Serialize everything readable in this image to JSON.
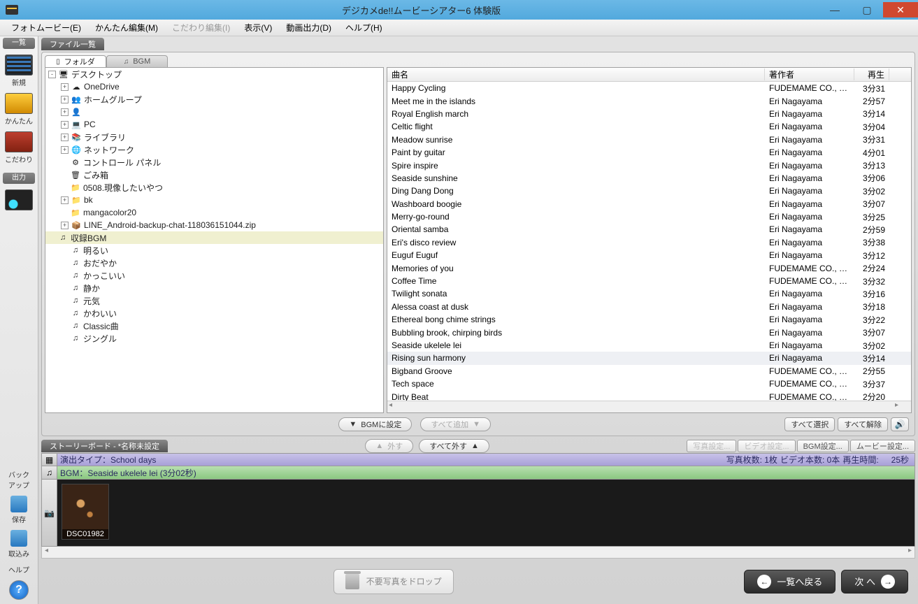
{
  "titlebar": {
    "title": "デジカメde!!ムービーシアター6 体験版"
  },
  "menu": {
    "items": [
      "フォトムービー(E)",
      "かんたん編集(M)",
      "こだわり編集(I)",
      "表示(V)",
      "動画出力(D)",
      "ヘルプ(H)"
    ]
  },
  "rail": {
    "list": "一覧",
    "buttons": {
      "new": "新規",
      "kantan": "かんたん",
      "kodawari": "こだわり"
    },
    "output": "出力",
    "backup": "バック\nアップ",
    "save": "保存",
    "load": "取込み",
    "help": "ヘルプ"
  },
  "file_tab": "ファイル一覧",
  "tabs": {
    "folder": "フォルダ",
    "bgm": "BGM"
  },
  "tree": [
    {
      "lvl": 0,
      "exp": "-",
      "icon": "🖥",
      "label": "デスクトップ"
    },
    {
      "lvl": 1,
      "exp": "+",
      "icon": "☁",
      "label": "OneDrive"
    },
    {
      "lvl": 1,
      "exp": "+",
      "icon": "👥",
      "label": "ホームグループ"
    },
    {
      "lvl": 1,
      "exp": "+",
      "icon": "👤",
      "label": "　　　　"
    },
    {
      "lvl": 1,
      "exp": "+",
      "icon": "💻",
      "label": "PC"
    },
    {
      "lvl": 1,
      "exp": "+",
      "icon": "📚",
      "label": "ライブラリ"
    },
    {
      "lvl": 1,
      "exp": "+",
      "icon": "🌐",
      "label": "ネットワーク"
    },
    {
      "lvl": 1,
      "exp": "",
      "icon": "⚙",
      "label": "コントロール パネル"
    },
    {
      "lvl": 1,
      "exp": "",
      "icon": "🗑",
      "label": "ごみ箱"
    },
    {
      "lvl": 1,
      "exp": "",
      "icon": "📁",
      "label": "0508.現像したいやつ"
    },
    {
      "lvl": 1,
      "exp": "+",
      "icon": "📁",
      "label": "bk"
    },
    {
      "lvl": 1,
      "exp": "",
      "icon": "📁",
      "label": "mangacolor20"
    },
    {
      "lvl": 1,
      "exp": "+",
      "icon": "📦",
      "label": "LINE_Android-backup-chat-118036151044.zip"
    },
    {
      "lvl": 0,
      "exp": "",
      "icon": "♫",
      "label": "収録BGM",
      "sel": true
    },
    {
      "lvl": 1,
      "exp": "",
      "icon": "♫",
      "label": "明るい"
    },
    {
      "lvl": 1,
      "exp": "",
      "icon": "♫",
      "label": "おだやか"
    },
    {
      "lvl": 1,
      "exp": "",
      "icon": "♫",
      "label": "かっこいい"
    },
    {
      "lvl": 1,
      "exp": "",
      "icon": "♫",
      "label": "静か"
    },
    {
      "lvl": 1,
      "exp": "",
      "icon": "♫",
      "label": "元気"
    },
    {
      "lvl": 1,
      "exp": "",
      "icon": "♫",
      "label": "かわいい"
    },
    {
      "lvl": 1,
      "exp": "",
      "icon": "♫",
      "label": "Classic曲"
    },
    {
      "lvl": 1,
      "exp": "",
      "icon": "♫",
      "label": "ジングル"
    }
  ],
  "list": {
    "headers": {
      "title": "曲名",
      "author": "著作者",
      "play": "再生"
    },
    "rows": [
      {
        "t": "Happy Cycling",
        "a": "FUDEMAME CO., L...",
        "d": "3分31"
      },
      {
        "t": "Meet me in the islands",
        "a": "Eri Nagayama",
        "d": "2分57"
      },
      {
        "t": "Royal English march",
        "a": "Eri Nagayama",
        "d": "3分14"
      },
      {
        "t": "Celtic flight",
        "a": "Eri Nagayama",
        "d": "3分04"
      },
      {
        "t": "Meadow sunrise",
        "a": "Eri Nagayama",
        "d": "3分31"
      },
      {
        "t": "Paint by guitar",
        "a": "Eri Nagayama",
        "d": "4分01"
      },
      {
        "t": "Spire inspire",
        "a": "Eri Nagayama",
        "d": "3分13"
      },
      {
        "t": "Seaside sunshine",
        "a": "Eri Nagayama",
        "d": "3分06"
      },
      {
        "t": "Ding Dang Dong",
        "a": "Eri Nagayama",
        "d": "3分02"
      },
      {
        "t": "Washboard boogie",
        "a": "Eri Nagayama",
        "d": "3分07"
      },
      {
        "t": "Merry-go-round",
        "a": "Eri Nagayama",
        "d": "3分25"
      },
      {
        "t": "Oriental samba",
        "a": "Eri Nagayama",
        "d": "2分59"
      },
      {
        "t": "Eri's disco review",
        "a": "Eri Nagayama",
        "d": "3分38"
      },
      {
        "t": "Euguf Euguf",
        "a": "Eri Nagayama",
        "d": "3分12"
      },
      {
        "t": "Memories of you",
        "a": "FUDEMAME CO., L...",
        "d": "2分24"
      },
      {
        "t": "Coffee Time",
        "a": "FUDEMAME CO., L...",
        "d": "3分32"
      },
      {
        "t": "Twilight sonata",
        "a": "Eri Nagayama",
        "d": "3分16"
      },
      {
        "t": "Alessa coast at dusk",
        "a": "Eri Nagayama",
        "d": "3分18"
      },
      {
        "t": "Ethereal bong chime strings",
        "a": "Eri Nagayama",
        "d": "3分22"
      },
      {
        "t": "Bubbling brook, chirping birds",
        "a": "Eri Nagayama",
        "d": "3分07"
      },
      {
        "t": "Seaside ukelele lei",
        "a": "Eri Nagayama",
        "d": "3分02"
      },
      {
        "t": "Rising sun harmony",
        "a": "Eri Nagayama",
        "d": "3分14",
        "sel": true
      },
      {
        "t": "Bigband Groove",
        "a": "FUDEMAME CO., L...",
        "d": "2分55"
      },
      {
        "t": "Tech space",
        "a": "FUDEMAME CO., L...",
        "d": "3分37"
      },
      {
        "t": "Dirty Beat",
        "a": "FUDEMAME CO., L...",
        "d": "2分20"
      }
    ]
  },
  "panel_btns": {
    "set_bgm": "BGMに設定",
    "add_all": "すべて追加",
    "select_all": "すべて選択",
    "deselect_all": "すべて解除"
  },
  "story": {
    "tab": "ストーリーボード - *名称未設定",
    "out": "外す",
    "out_all": "すべて外す",
    "photo_set": "写真設定...",
    "video_set": "ビデオ設定...",
    "bgm_set": "BGM設定...",
    "movie_set": "ムービー設定..."
  },
  "info1": {
    "type_label": "演出タイプ：",
    "type_value": "School days",
    "photo_count_label": "写真枚数:",
    "photo_count_value": "1枚",
    "video_count_label": "ビデオ本数:",
    "video_count_value": "0本",
    "playtime_label": "再生時間:",
    "playtime_value": "25秒"
  },
  "info2": {
    "bgm_label": "BGM：",
    "bgm_value": "Seaside ukelele lei (3分02秒)"
  },
  "thumb": {
    "caption": "DSC01982"
  },
  "footer": {
    "drop_hint": "不要写真をドロップ",
    "back": "一覧へ戻る",
    "next": "次 へ"
  }
}
